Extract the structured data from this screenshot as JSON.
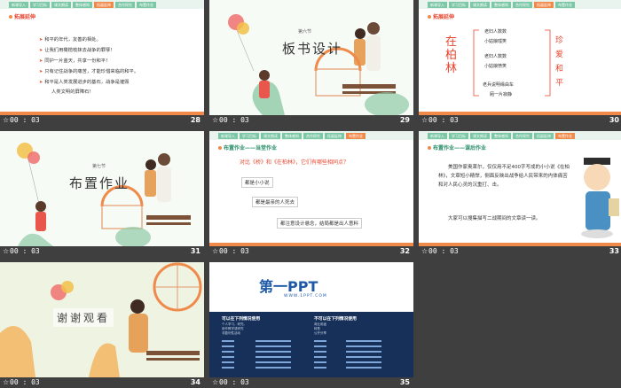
{
  "nav": [
    "新课导入",
    "学习目标",
    "课文朗读",
    "整体感知",
    "合作探究",
    "拓展延伸",
    "布置作业"
  ],
  "slides": [
    {
      "num": "28",
      "time": "00 : 03",
      "title": "拓展延伸",
      "bullets": [
        "和平的年代，友善的相处。",
        "让我们用橄榄枝抹去战争的罪孽！",
        "同护一片蓝天，共享一份和平！",
        "只有记住战争的痛苦，才能珍惜来临的和平。",
        "和平是人类发展进步的基石，战争是摧毁",
        "人类文明的屏障石！"
      ]
    },
    {
      "num": "29",
      "time": "00 : 03",
      "section": "第六节",
      "title": "板书设计"
    },
    {
      "num": "30",
      "time": "00 : 03",
      "title": "拓展延伸",
      "left": "在柏林",
      "right": "珍爱和平",
      "lines": [
        "老妇人数数",
        "小姑娘嗤笑",
        "老妇人数数",
        "小姑娘愤笑",
        "老兵说明缘由车",
        "厢一片寂静"
      ]
    },
    {
      "num": "31",
      "time": "00 : 03",
      "section": "第七节",
      "title": "布置作业"
    },
    {
      "num": "32",
      "time": "00 : 03",
      "title": "布置作业——当堂作业",
      "question": "对比《桥》和《在柏林》，它们有哪些相同点？",
      "answers": [
        "都是小小说",
        "都是最亲的人死去",
        "都注意设计悬念，结局都是出人意料"
      ]
    },
    {
      "num": "33",
      "time": "00 : 03",
      "title": "布置作业——课后作业",
      "para1": "美国作家奥莱尔，仅仅用不足400字写成的小小说《在柏林》，文章短小精悍，侧面反映出战争给人民带来的内体痛苦和对人民心灵的沉重打、击。",
      "para2": "大家可以搜集描写二战期间的文章读一读。"
    },
    {
      "num": "34",
      "time": "00 : 03",
      "title": "谢谢观看"
    },
    {
      "num": "35",
      "time": "00 : 03",
      "brand": "第一PPT",
      "url": "WWW.1PPT.COM",
      "col1_title": "可以在下列情况使用",
      "col2_title": "不可以在下列情况使用",
      "col1_items": [
        "个人学习、研究。",
        "用作教学或研究",
        "非盈利性活动"
      ],
      "col2_items": [
        "商业用途",
        "转售",
        "公开分享"
      ]
    }
  ]
}
